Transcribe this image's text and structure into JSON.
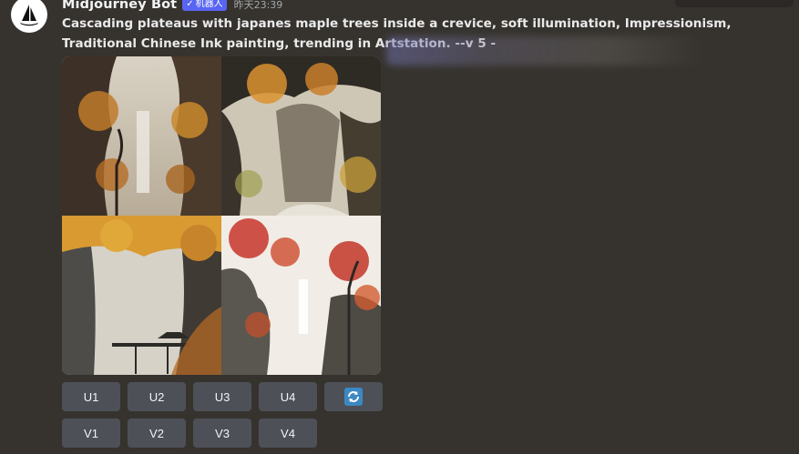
{
  "message": {
    "author": "Midjourney Bot",
    "bot_badge": "机器人",
    "badge_check": "✓",
    "timestamp": "昨天23:39",
    "prompt": "Cascading plateaus with japanes maple trees inside a crevice, soft illumination, Impressionism, Traditional Chinese Ink painting, trending in Artstation. --v 5 -"
  },
  "image_grid": {
    "tiles": [
      "upper-left",
      "upper-right",
      "lower-left",
      "lower-right"
    ]
  },
  "buttons": {
    "upscale": [
      "U1",
      "U2",
      "U3",
      "U4"
    ],
    "variation": [
      "V1",
      "V2",
      "V3",
      "V4"
    ],
    "reroll_icon": "refresh-icon"
  },
  "colors": {
    "background": "#36332e",
    "button": "#4e5058",
    "badge": "#5865f2",
    "reroll": "#3b88c3"
  }
}
